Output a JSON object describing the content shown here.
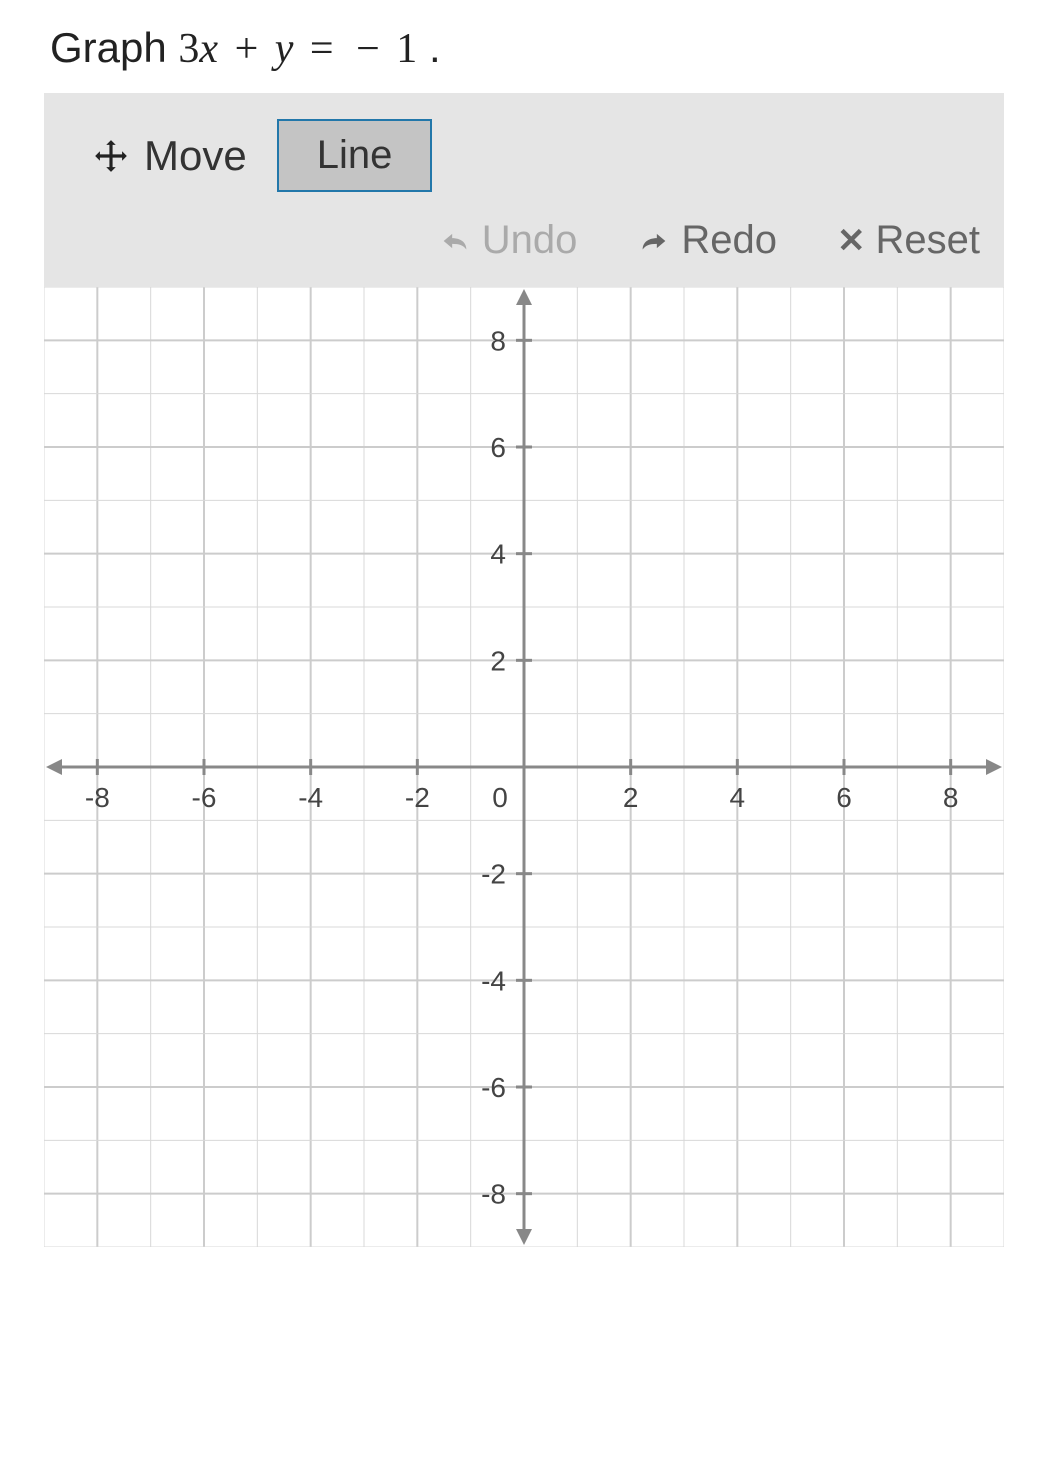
{
  "question": {
    "prefix": "Graph ",
    "equation_parts": {
      "coef": "3",
      "x": "x",
      "plus": " + ",
      "y": "y",
      "eq": " = ",
      "neg": " − ",
      "one": "1",
      "dot": " ."
    }
  },
  "tools": {
    "move": "Move",
    "line": "Line",
    "undo": "Undo",
    "redo": "Redo",
    "reset": "Reset"
  },
  "chart_data": {
    "type": "empty-coordinate-plane",
    "x_range": [
      -9,
      9
    ],
    "y_range": [
      -9,
      9
    ],
    "x_ticks": [
      -8,
      -6,
      -4,
      -2,
      0,
      2,
      4,
      6,
      8
    ],
    "y_ticks": [
      -8,
      -6,
      -4,
      -2,
      2,
      4,
      6,
      8
    ],
    "origin_label": "0",
    "grid_step": 1
  }
}
